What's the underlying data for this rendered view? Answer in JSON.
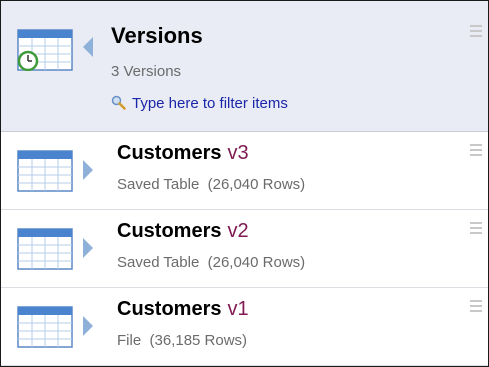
{
  "header": {
    "title": "Versions",
    "subtitle": "3 Versions",
    "filter_placeholder": "Type here to filter items",
    "icon": "clock-table-icon"
  },
  "versions": [
    {
      "name": "Customers",
      "version": "v3",
      "detail": "Saved Table  (26,040 Rows)"
    },
    {
      "name": "Customers",
      "version": "v2",
      "detail": "Saved Table  (26,040 Rows)"
    },
    {
      "name": "Customers",
      "version": "v1",
      "detail": "File  (36,185 Rows)"
    }
  ],
  "colors": {
    "header_bg": "#e9ecf5",
    "version_accent": "#7f1a52",
    "filter_link": "#1a25a8",
    "arrow": "#8fb0d9"
  }
}
